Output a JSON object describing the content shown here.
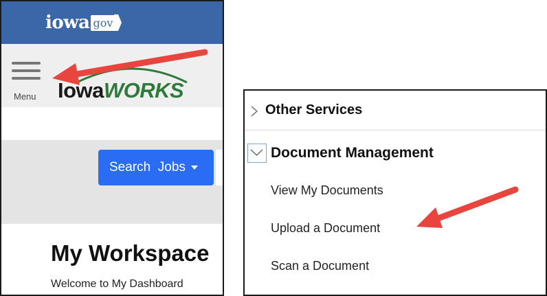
{
  "left": {
    "gov_logo": {
      "main": "iowa",
      "suffix": "gov"
    },
    "menu_label": "Menu",
    "site_logo": {
      "part1": "Iowa",
      "part2": "WORKS"
    },
    "search_button": "Search  Jobs",
    "title": "My Workspace",
    "subtitle": "Welcome to My Dashboard"
  },
  "right": {
    "other_services": "Other Services",
    "document_management": "Document Management",
    "items": [
      "View My Documents",
      "Upload a Document",
      "Scan a Document"
    ]
  },
  "colors": {
    "gov_bar": "#3b66a8",
    "search_button": "#2a6df4",
    "logo_green": "#2d7a3a",
    "annotation_arrow": "#e8453f"
  },
  "icons": [
    "hamburger-menu-icon",
    "chevron-down-icon",
    "chevron-right-icon",
    "arrow-annotation"
  ]
}
